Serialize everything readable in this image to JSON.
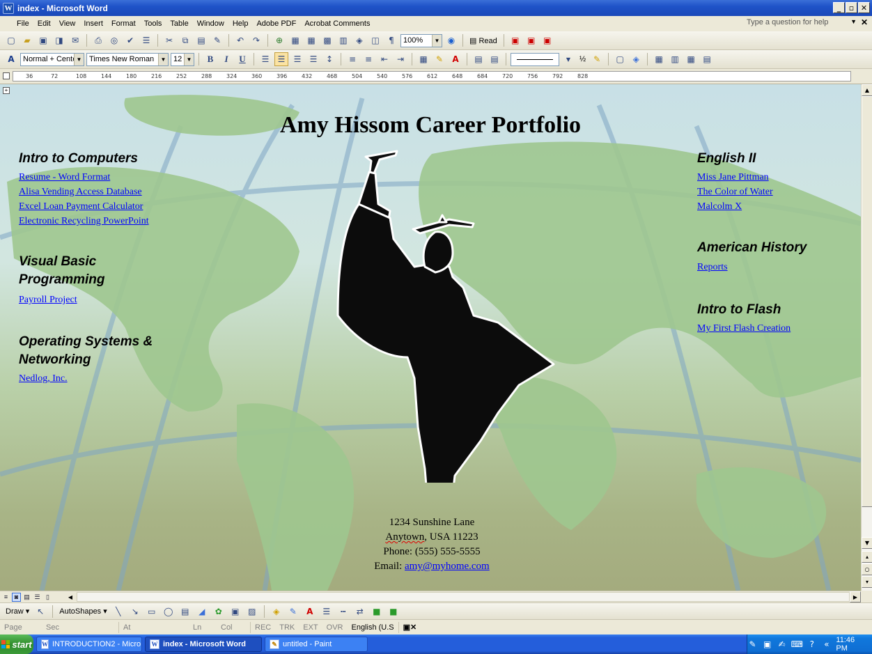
{
  "window": {
    "title": "index - Microsoft Word",
    "min_label": "_",
    "max_label": "▫",
    "close_label": "✕"
  },
  "menubar": {
    "items": [
      "File",
      "Edit",
      "View",
      "Insert",
      "Format",
      "Tools",
      "Table",
      "Window",
      "Help",
      "Adobe PDF",
      "Acrobat Comments"
    ],
    "help_placeholder": "Type a question for help"
  },
  "formatting": {
    "style": "Normal + Cente",
    "font": "Times New Roman",
    "size": "12",
    "zoom": "100%",
    "read_label": "Read",
    "fraction": "½"
  },
  "ruler": {
    "marks": [
      "36",
      "72",
      "108",
      "144",
      "180",
      "216",
      "252",
      "288",
      "324",
      "360",
      "396",
      "432",
      "468",
      "504",
      "540",
      "576",
      "612",
      "648",
      "684",
      "720",
      "756",
      "792",
      "828"
    ]
  },
  "document": {
    "title": "Amy Hissom Career Portfolio",
    "left_sections": [
      {
        "heading": "Intro to Computers",
        "links": [
          "Resume -  Word Format",
          "Alisa Vending Access Database",
          "Excel Loan Payment Calculator",
          "Electronic Recycling PowerPoint"
        ]
      },
      {
        "heading_line1": "Visual Basic",
        "heading_line2": "Programming",
        "links": [
          "Payroll Project"
        ]
      },
      {
        "heading_line1": "Operating Systems &",
        "heading_line2": "Networking",
        "links": [
          "Nedlog, Inc."
        ]
      }
    ],
    "right_sections": [
      {
        "heading": "English II",
        "links": [
          "Miss Jane Pittman",
          "The Color of Water",
          "Malcolm X"
        ]
      },
      {
        "heading": "American History",
        "links": [
          "Reports"
        ]
      },
      {
        "heading": "Intro to Flash",
        "links": [
          "My First Flash Creation"
        ]
      }
    ],
    "address": {
      "line1": "1234 Sunshine Lane",
      "line2_city": "Anytown",
      "line2_rest": ", USA 11223",
      "phone": "Phone:  (555) 555-5555",
      "email_label": "Email:",
      "email": "amy@myhome.com"
    }
  },
  "drawbar": {
    "draw_label": "Draw",
    "autoshapes_label": "AutoShapes"
  },
  "statusbar": {
    "page": "Page",
    "sec": "Sec",
    "at": "At",
    "ln": "Ln",
    "col": "Col",
    "rec": "REC",
    "trk": "TRK",
    "ext": "EXT",
    "ovr": "OVR",
    "language": "English (U.S"
  },
  "taskbar": {
    "start_label": "start",
    "tasks": [
      "INTRODUCTION2 - Micro...",
      "index - Microsoft Word",
      "untitled - Paint"
    ],
    "clock": "11:46 PM"
  },
  "colors": {
    "link": "#0000ff",
    "titlebar": "#1f53c8",
    "land": "#9fc78f",
    "ocean": "#c8e0e6"
  }
}
